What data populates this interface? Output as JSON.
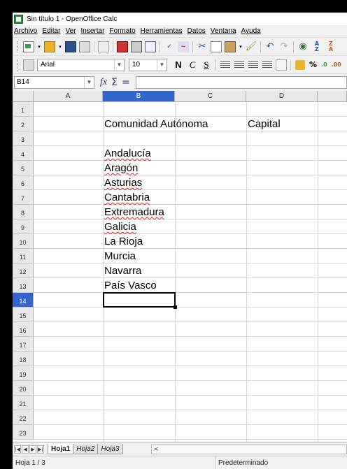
{
  "window": {
    "title": "Sin título 1 - OpenOffice Calc"
  },
  "menubar": {
    "items": [
      "Archivo",
      "Editar",
      "Ver",
      "Insertar",
      "Formato",
      "Herramientas",
      "Datos",
      "Ventana",
      "Ayuda"
    ]
  },
  "format_toolbar": {
    "font_name": "Arial",
    "font_size": "10",
    "bold_label": "N",
    "italic_label": "C",
    "underline_label": "S",
    "percent_label": "%"
  },
  "formula_bar": {
    "cell_reference": "B14",
    "formula_value": ""
  },
  "grid": {
    "columns": [
      "A",
      "B",
      "C",
      "D"
    ],
    "selected_column": "B",
    "rows": [
      "1",
      "2",
      "3",
      "4",
      "5",
      "6",
      "7",
      "8",
      "9",
      "10",
      "11",
      "12",
      "13",
      "14",
      "15",
      "16",
      "17",
      "18",
      "19",
      "20",
      "21",
      "22",
      "23"
    ],
    "selected_row": "14",
    "cells": {
      "B2": "Comunidad Autónoma",
      "D2": "Capital",
      "B4": "Andalucía",
      "B5": "Aragón",
      "B6": "Asturias",
      "B7": "Cantabria",
      "B8": "Extremadura",
      "B9": "Galicia",
      "B10": "La Rioja",
      "B11": "Murcia",
      "B12": "Navarra",
      "B13": "País Vasco"
    }
  },
  "sheet_tabs": [
    "Hoja1",
    "Hoja2",
    "Hoja3"
  ],
  "active_sheet": "Hoja1",
  "statusbar": {
    "sheet_position": "Hoja 1 / 3",
    "page_style": "Predeterminado"
  }
}
